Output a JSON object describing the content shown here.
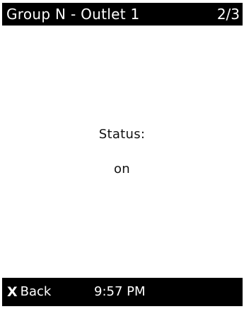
{
  "header": {
    "title": "Group N - Outlet 1",
    "page_indicator": "2/3"
  },
  "main": {
    "status_label": "Status:",
    "status_value": "on"
  },
  "footer": {
    "back_icon": "X",
    "back_label": "Back",
    "time": "9:57 PM"
  },
  "colors": {
    "bar_background": "#000000",
    "bar_text": "#ffffff",
    "screen_background": "#ffffff",
    "body_text": "#111111"
  }
}
